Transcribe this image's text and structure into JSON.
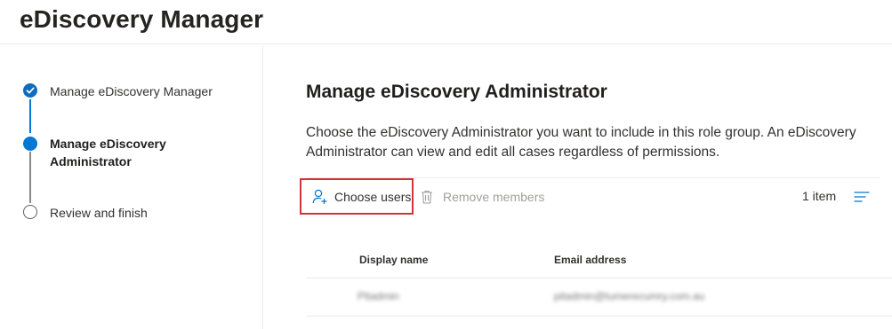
{
  "app": {
    "title": "eDiscovery Manager"
  },
  "wizard": {
    "steps": [
      {
        "label": "Manage eDiscovery Manager",
        "state": "completed"
      },
      {
        "label": "Manage eDiscovery Administrator",
        "state": "current"
      },
      {
        "label": "Review and finish",
        "state": "pending"
      }
    ]
  },
  "main": {
    "title": "Manage eDiscovery Administrator",
    "description": "Choose the eDiscovery Administrator you want to include in this role group. An eDiscovery Administrator can view and edit all cases regardless of permissions.",
    "toolbar": {
      "choose_users": "Choose users",
      "remove_members": "Remove members",
      "item_count": "1 item",
      "choose_icon": "add-person-icon",
      "remove_icon": "trash-icon",
      "filter_icon": "filter-lines-icon"
    },
    "table": {
      "columns": [
        "Display name",
        "Email address"
      ],
      "rows": [
        {
          "display_name": "Pitadmin",
          "email": "pitadmin@tumerecumry.com.au"
        }
      ]
    }
  },
  "colors": {
    "accent": "#0078d4",
    "highlight_border": "#d13438",
    "disabled_text": "#a19f9d"
  }
}
